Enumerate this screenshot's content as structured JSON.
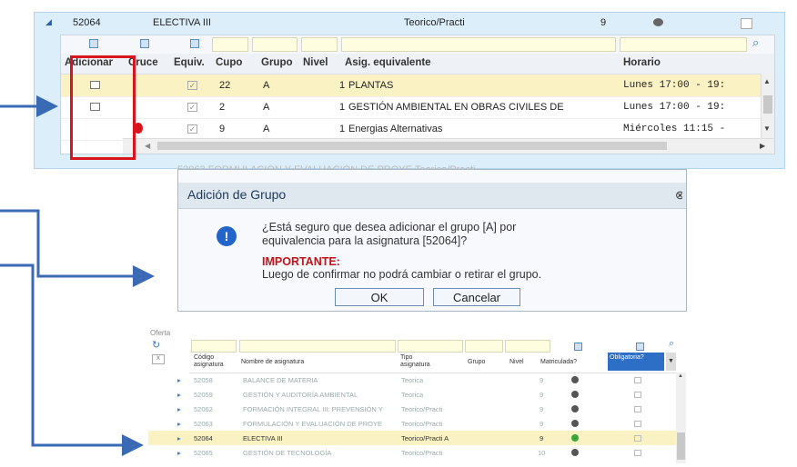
{
  "top": {
    "course_row": {
      "code": "52064",
      "name": "ELECTIVA III",
      "type": "Teorico/Practi",
      "level": "9"
    },
    "headers": [
      "Adicionar",
      "Cruce",
      "Equiv.",
      "Cupo",
      "Grupo",
      "Nivel",
      "Asig. equivalente",
      "Horario"
    ],
    "rows": [
      {
        "cupo": "22",
        "grupo": "A",
        "nivel": "1",
        "asig": "PLANTAS",
        "horario": "Lunes 17:00 - 19:"
      },
      {
        "cupo": "2",
        "grupo": "A",
        "nivel": "1",
        "asig": "GESTIÓN AMBIENTAL EN OBRAS CIVILES DE",
        "horario": "Lunes 17:00 - 19:"
      },
      {
        "cupo": "9",
        "grupo": "A",
        "nivel": "1",
        "asig": "Energias Alternativas",
        "horario": "Miércoles 11:15 -"
      }
    ],
    "partial_row": "52063     FORMULACIÓN Y EVALUACIÓN DE PROYE Teorico/Practi"
  },
  "dialog": {
    "title": "Adición de Grupo",
    "question_line1": "¿Está seguro que desea adicionar el grupo [A] por",
    "question_line2": "equivalencia para la asignatura [52064]?",
    "important_label": "IMPORTANTE:",
    "important_text": "Luego de confirmar no podrá cambiar o retirar el grupo.",
    "ok_label": "OK",
    "cancel_label": "Cancelar",
    "info_glyph": "!"
  },
  "bottom": {
    "section_label": "Oferta",
    "headers": {
      "code": "Código asignatura",
      "name": "Nombre de asignatura",
      "type": "Tipo asignatura",
      "group": "Grupo",
      "level": "Nivel",
      "enrolled": "Matriculada?",
      "required": "Obligatoria?"
    },
    "rows": [
      {
        "code": "52058",
        "name": "BALANCE DE MATERIA",
        "type": "Teorica",
        "level": "9"
      },
      {
        "code": "52059",
        "name": "GESTIÓN Y AUDITORÍA AMBIENTAL",
        "type": "Teorica",
        "level": "9"
      },
      {
        "code": "52062",
        "name": "FORMACIÓN INTEGRAL III: PREVENSIÓN Y",
        "type": "Teorico/Practi",
        "level": "9"
      },
      {
        "code": "52063",
        "name": "FORMULACIÓN Y EVALUACIÓN DE PROYE",
        "type": "Teorico/Practi",
        "level": "9"
      },
      {
        "code": "52064",
        "name": "ELECTIVA III",
        "type": "Teorico/Practi A",
        "level": "9"
      },
      {
        "code": "52065",
        "name": "GESTIÓN DE TECNOLOGÍA",
        "type": "Teorico/Practi",
        "level": "10"
      }
    ]
  },
  "colors": {
    "accent": "#2f5fa8",
    "highlight": "#fbf2c4",
    "red_box": "#d9141c",
    "arrow": "#3a6ab4"
  }
}
